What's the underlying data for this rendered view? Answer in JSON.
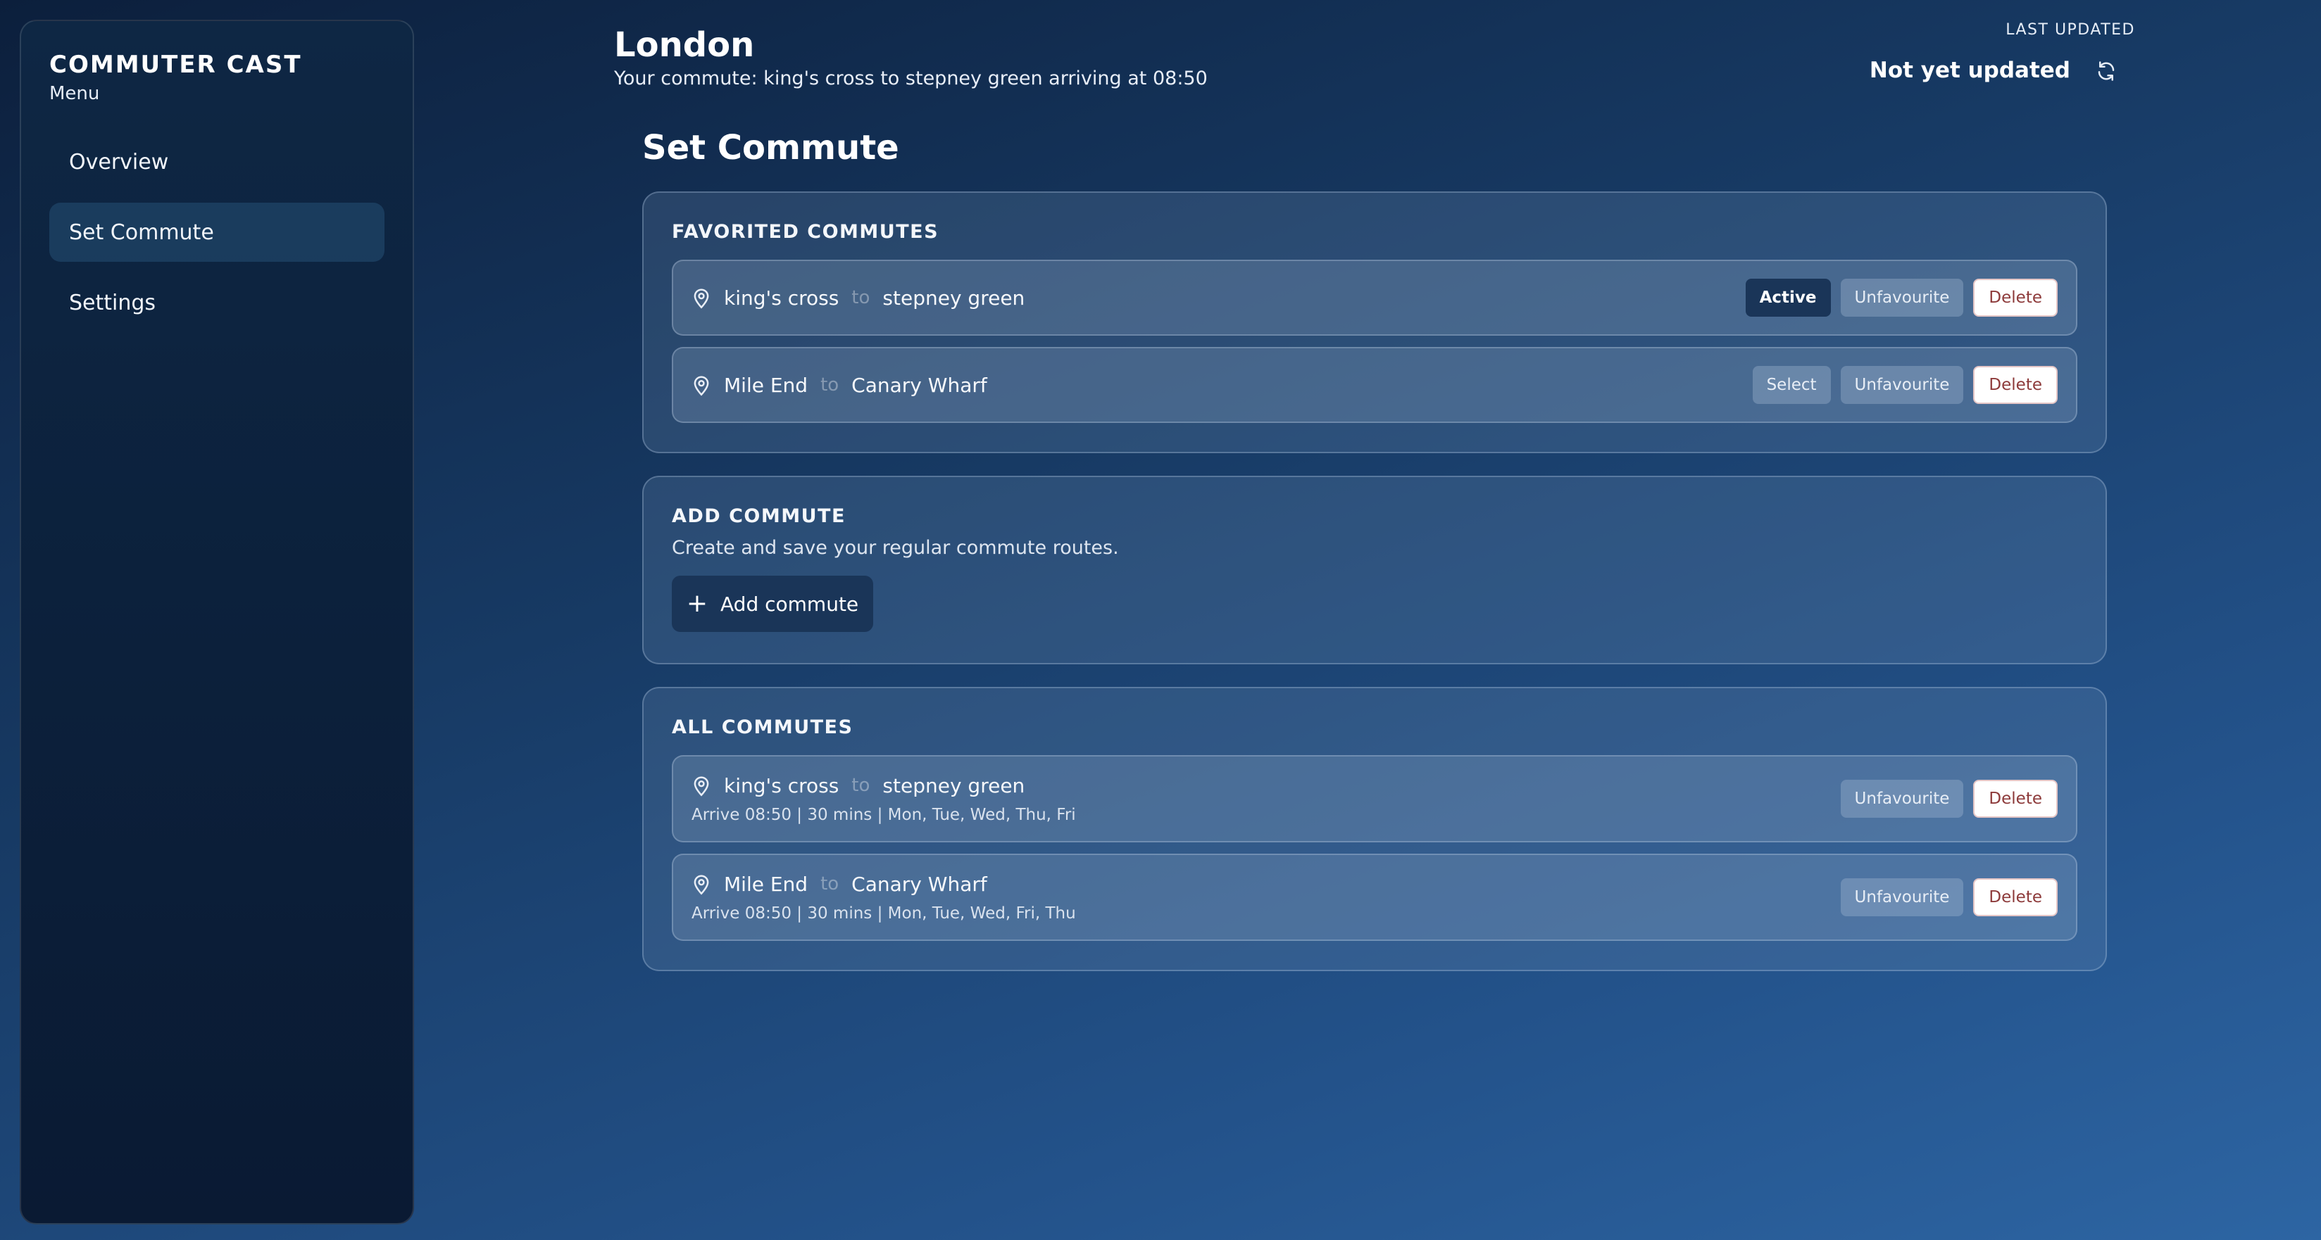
{
  "sidebar": {
    "brand": "COMMUTER CAST",
    "menu_label": "Menu",
    "items": [
      {
        "label": "Overview",
        "active": false
      },
      {
        "label": "Set Commute",
        "active": true
      },
      {
        "label": "Settings",
        "active": false
      }
    ]
  },
  "header": {
    "city": "London",
    "commute_summary": "Your commute: king's cross to stepney green arriving at 08:50",
    "last_updated_label": "LAST UPDATED",
    "last_updated_value": "Not yet updated"
  },
  "page_title": "Set Commute",
  "favorites": {
    "title": "FAVORITED COMMUTES",
    "connector": "to",
    "items": [
      {
        "from": "king's cross",
        "to": "stepney green",
        "primary_action": "Active",
        "unfav": "Unfavourite",
        "delete": "Delete"
      },
      {
        "from": "Mile End",
        "to": "Canary Wharf",
        "primary_action": "Select",
        "unfav": "Unfavourite",
        "delete": "Delete"
      }
    ]
  },
  "add": {
    "title": "ADD COMMUTE",
    "description": "Create and save your regular commute routes.",
    "button_label": "Add commute"
  },
  "all": {
    "title": "ALL COMMUTES",
    "items": [
      {
        "from": "king's cross",
        "to": "stepney green",
        "meta": "Arrive 08:50 | 30 mins | Mon, Tue, Wed, Thu, Fri",
        "unfav": "Unfavourite",
        "delete": "Delete"
      },
      {
        "from": "Mile End",
        "to": "Canary Wharf",
        "meta": "Arrive 08:50 | 30 mins | Mon, Tue, Wed, Fri, Thu",
        "unfav": "Unfavourite",
        "delete": "Delete"
      }
    ]
  },
  "icons": {
    "pin": "map-pin-icon",
    "refresh": "refresh-icon",
    "plus": "plus-icon"
  },
  "colors": {
    "accent": "#1a3558",
    "delete_text": "#8d3a3a"
  }
}
